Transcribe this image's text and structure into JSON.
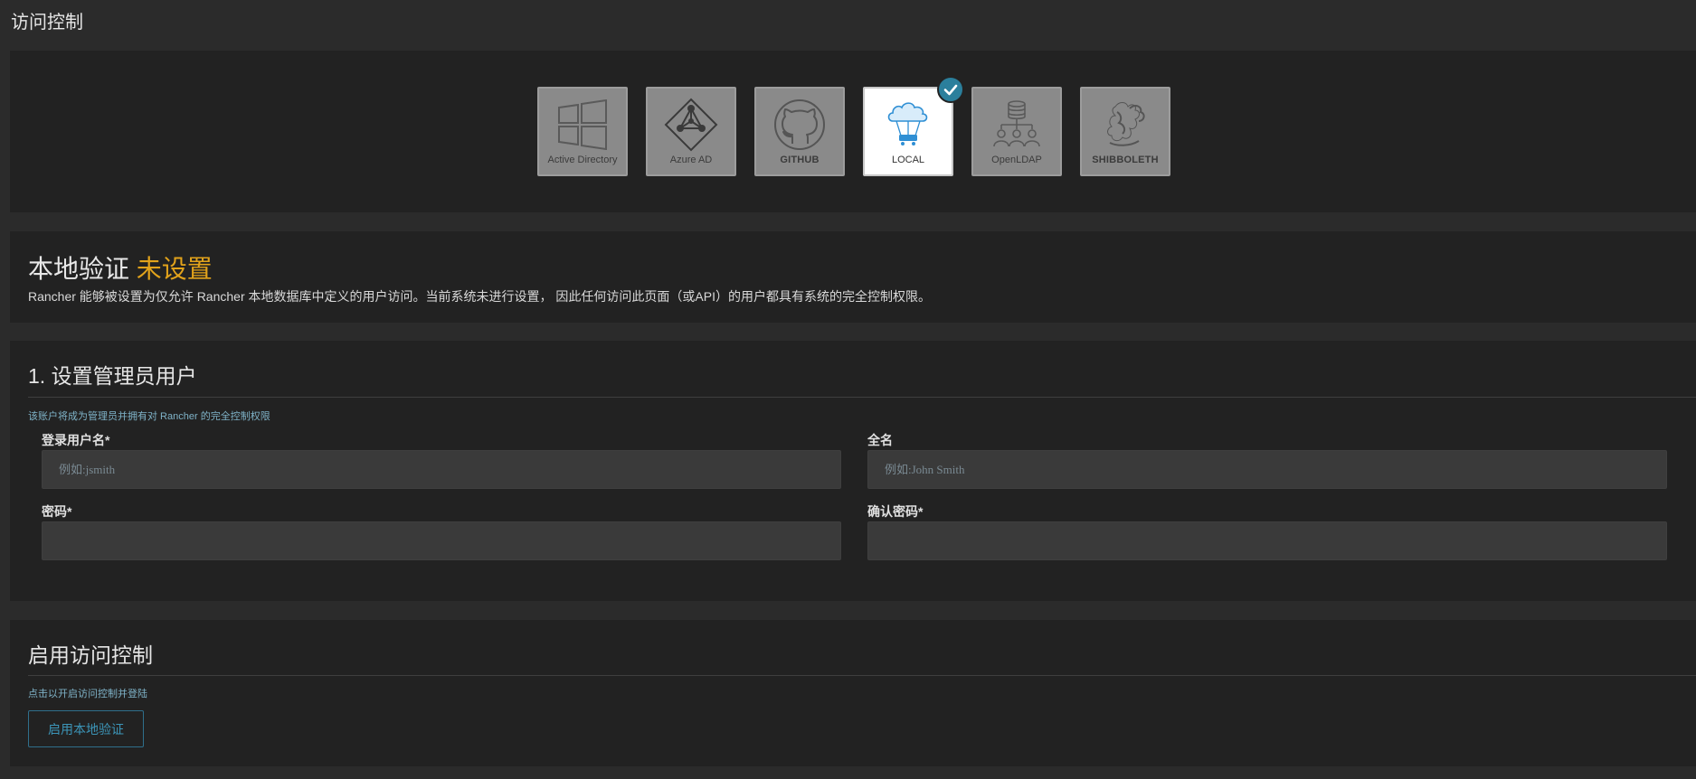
{
  "page": {
    "title": "访问控制"
  },
  "providers": [
    {
      "label": "Active Directory",
      "icon": "windows-icon",
      "active": false
    },
    {
      "label": "Azure AD",
      "icon": "azure-ad-icon",
      "active": false
    },
    {
      "label": "GITHUB",
      "icon": "github-icon",
      "active": false
    },
    {
      "label": "LOCAL",
      "icon": "local-cloud-icon",
      "active": true
    },
    {
      "label": "OpenLDAP",
      "icon": "openldap-icon",
      "active": false
    },
    {
      "label": "SHIBBOLETH",
      "icon": "shibboleth-icon",
      "active": false
    }
  ],
  "status": {
    "heading": "本地验证",
    "state": "未设置",
    "description": "Rancher 能够被设置为仅允许 Rancher 本地数据库中定义的用户访问。当前系统未进行设置， 因此任何访问此页面（或API）的用户都具有系统的完全控制权限。"
  },
  "admin": {
    "title": "1. 设置管理员用户",
    "help": "该账户将成为管理员并拥有对 Rancher 的完全控制权限",
    "username_label": "登录用户名*",
    "username_placeholder": "例如:jsmith",
    "fullname_label": "全名",
    "fullname_placeholder": "例如:John Smith",
    "password_label": "密码*",
    "confirm_label": "确认密码*"
  },
  "enable": {
    "title": "启用访问控制",
    "help": "点击以开启访问控制并登陆",
    "button": "启用本地验证"
  },
  "colors": {
    "accent": "#2b7f9c",
    "warning": "#e2a31b",
    "panel": "#222222",
    "background": "#2b2b2b"
  }
}
